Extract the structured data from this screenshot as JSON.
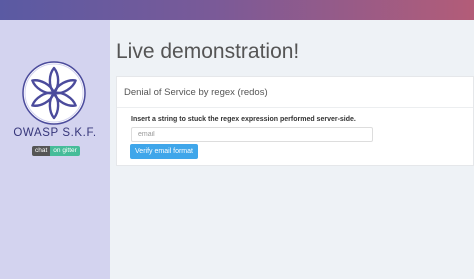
{
  "sidebar": {
    "brand": "OWASP S.K.F.",
    "chat_badge": {
      "left": "chat",
      "right": "on gitter"
    }
  },
  "main": {
    "title": "Live demonstration!",
    "panel": {
      "heading": "Denial of Service by regex (redos)",
      "instruction": "Insert a string to stuck the regex expression performed server-side.",
      "input": {
        "placeholder": "email",
        "value": ""
      },
      "button_label": "Verify email format"
    }
  },
  "colors": {
    "sidebar_bg": "#d3d3ef",
    "accent_button": "#3fa6ea",
    "logo": "#4b4b9c"
  },
  "icons": {
    "logo": "flower-logo-icon"
  }
}
